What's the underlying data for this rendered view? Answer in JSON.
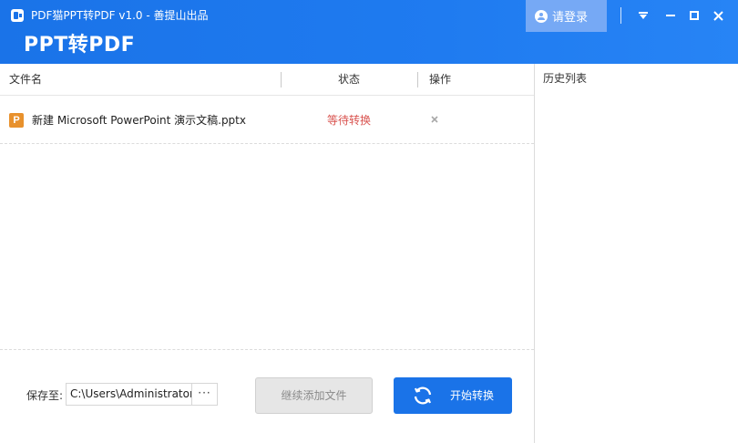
{
  "window": {
    "title": "PDF猫PPT转PDF v1.0 - 善提山出品",
    "brand": "PPT转PDF",
    "login_label": "请登录"
  },
  "table": {
    "headers": {
      "name": "文件名",
      "status": "状态",
      "action": "操作"
    },
    "rows": [
      {
        "icon": "ppt-icon",
        "icon_letter": "P",
        "name": "新建 Microsoft PowerPoint 演示文稿.pptx",
        "status": "等待转换",
        "action": "×"
      }
    ]
  },
  "footer": {
    "save_label": "保存至:",
    "save_path": "C:\\Users\\Administrator",
    "browse_label": "···",
    "add_files_label": "继续添加文件",
    "start_label": "开始转换"
  },
  "history": {
    "title": "历史列表"
  },
  "colors": {
    "header_bg": "#1a73e8",
    "login_bg": "#76a9f5",
    "status_pending": "#d9534f",
    "ppt_icon": "#e8912d",
    "primary_button": "#1a73e8",
    "disabled_button": "#e6e6e6"
  },
  "icons": {
    "app": "app-logo-icon",
    "user": "user-icon",
    "menu": "menu-dropdown-icon",
    "minimize": "minimize-icon",
    "maximize": "maximize-icon",
    "close": "close-icon",
    "remove": "remove-icon",
    "refresh": "refresh-icon"
  }
}
